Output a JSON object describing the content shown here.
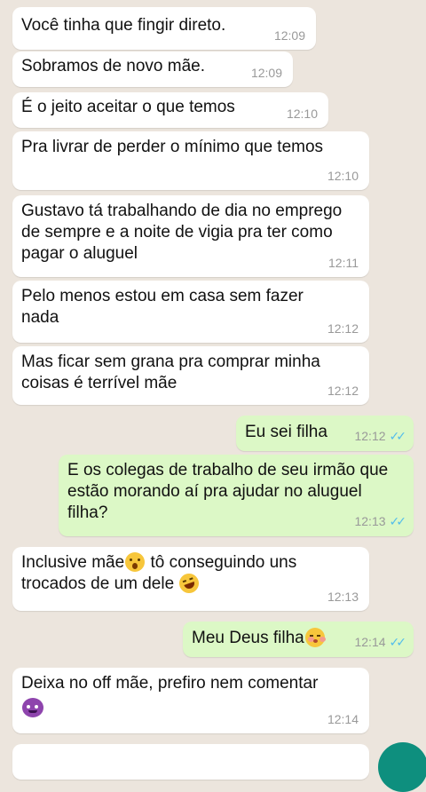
{
  "messages": [
    {
      "text": "Você tinha que fingir direto.",
      "time": "12:09"
    },
    {
      "text": "Sobramos de novo mãe.",
      "time": "12:09"
    },
    {
      "text": "É o jeito aceitar o que temos",
      "time": "12:10"
    },
    {
      "text": "Pra livrar de perder o mínimo que temos",
      "time": "12:10"
    },
    {
      "text": "Gustavo tá trabalhando de dia no emprego de sempre e a noite de vigia pra ter como pagar o aluguel",
      "time": "12:11"
    },
    {
      "text": "Pelo menos estou em casa sem fazer nada",
      "time": "12:12"
    },
    {
      "text": "Mas ficar sem grana pra comprar minha coisas é terrível mãe",
      "time": "12:12"
    },
    {
      "text": "Eu sei filha",
      "time": "12:12"
    },
    {
      "text": "E os colegas de trabalho de seu irmão que estão morando aí pra ajudar no aluguel filha?",
      "time": "12:13"
    },
    {
      "text_a": "Inclusive mãe",
      "text_b": " tô conseguindo uns trocados de um dele ",
      "time": "12:13"
    },
    {
      "text": "Meu Deus filha",
      "time": "12:14"
    },
    {
      "text": "Deixa no off mãe, prefiro nem comentar",
      "time": "12:14"
    }
  ],
  "read_ticks": "✓✓",
  "colors": {
    "background": "#ece5dd",
    "incoming": "#ffffff",
    "outgoing": "#dcf8c6",
    "read_ticks": "#53bdeb",
    "fab": "#0e8f7e"
  },
  "icons": [
    "astonished-emoji",
    "rofl-emoji",
    "blush-kiss-emoji",
    "devil-emoji",
    "double-check-icon"
  ]
}
